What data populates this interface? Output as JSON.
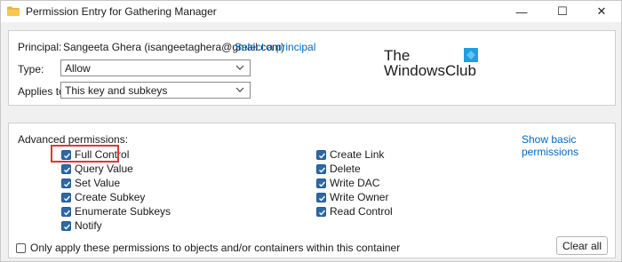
{
  "window": {
    "title": "Permission Entry for Gathering Manager",
    "controls": {
      "minimize": "—",
      "maximize": "☐",
      "close": "✕"
    }
  },
  "principal": {
    "label": "Principal:",
    "value": "Sangeeta Ghera (isangeetaghera@gmail.com)",
    "select_link": "Select a principal"
  },
  "type": {
    "label": "Type:",
    "value": "Allow"
  },
  "applies_to": {
    "label": "Applies to:",
    "value": "This key and subkeys"
  },
  "logo": {
    "line1": "The",
    "line2": "WindowsClub",
    "accent_color": "#1aa0e6"
  },
  "advanced": {
    "heading": "Advanced permissions:",
    "show_basic_link": "Show basic permissions",
    "left_column": [
      {
        "label": "Full Control",
        "checked": true,
        "highlighted": true
      },
      {
        "label": "Query Value",
        "checked": true
      },
      {
        "label": "Set Value",
        "checked": true
      },
      {
        "label": "Create Subkey",
        "checked": true
      },
      {
        "label": "Enumerate Subkeys",
        "checked": true
      },
      {
        "label": "Notify",
        "checked": true
      }
    ],
    "right_column": [
      {
        "label": "Create Link",
        "checked": true
      },
      {
        "label": "Delete",
        "checked": true
      },
      {
        "label": "Write DAC",
        "checked": true
      },
      {
        "label": "Write Owner",
        "checked": true
      },
      {
        "label": "Read Control",
        "checked": true
      }
    ],
    "only_apply": {
      "label": "Only apply these permissions to objects and/or containers within this container",
      "checked": false
    },
    "clear_all": "Clear all"
  },
  "colors": {
    "checkbox": "#2c6aa6",
    "link": "#0067c0",
    "highlight": "#d63a3a"
  }
}
